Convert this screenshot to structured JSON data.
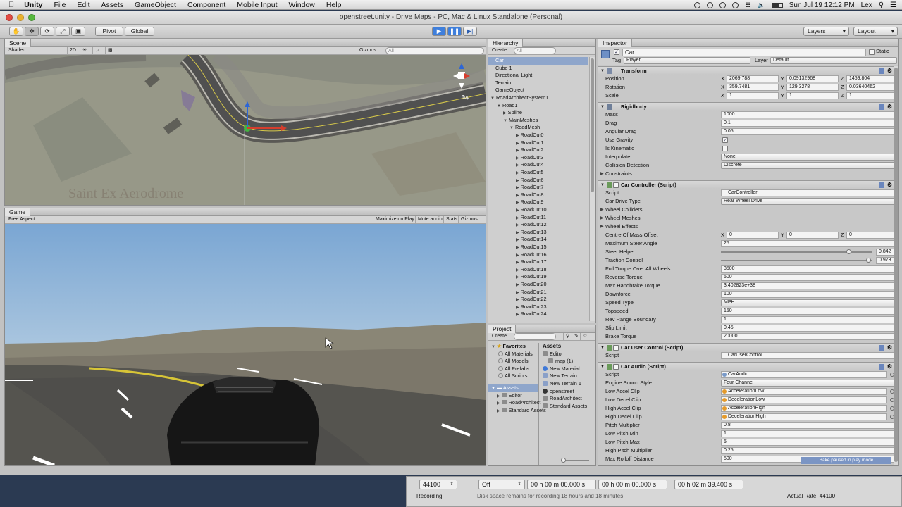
{
  "menubar": {
    "app": "Unity",
    "items": [
      "File",
      "Edit",
      "Assets",
      "GameObject",
      "Component",
      "Mobile Input",
      "Window",
      "Help"
    ],
    "clock": "Sun Jul 19  12:12 PM",
    "user": "Lex"
  },
  "window": {
    "title": "openstreet.unity - Drive Maps - PC, Mac & Linux Standalone (Personal)"
  },
  "toolbar": {
    "pivot": "Pivot",
    "global": "Global",
    "layers": "Layers",
    "layout": "Layout",
    "colors": {
      "play_active": "#3f7fdc"
    }
  },
  "scene": {
    "tab": "Scene",
    "shading": "Shaded",
    "mode2d": "2D",
    "gizmos": "Gizmos",
    "search_placeholder": "All",
    "axis_label": "Top",
    "watermark": "Saint Ex Aerodrome"
  },
  "game": {
    "tab": "Game",
    "aspect": "Free Aspect",
    "maximize": "Maximize on Play",
    "mute": "Mute audio",
    "stats": "Stats",
    "gizmos": "Gizmos"
  },
  "hierarchy": {
    "tab": "Hierarchy",
    "create": "Create",
    "search_placeholder": "All",
    "items": [
      {
        "label": "Car",
        "depth": 0,
        "arrow": "",
        "selected": true
      },
      {
        "label": "Cube 1",
        "depth": 0,
        "arrow": ""
      },
      {
        "label": "Directional Light",
        "depth": 0,
        "arrow": ""
      },
      {
        "label": "Terrain",
        "depth": 0,
        "arrow": ""
      },
      {
        "label": "GameObject",
        "depth": 0,
        "arrow": ""
      },
      {
        "label": "RoadArchitectSystem1",
        "depth": 0,
        "arrow": "▼"
      },
      {
        "label": "Road1",
        "depth": 1,
        "arrow": "▼"
      },
      {
        "label": "Spline",
        "depth": 2,
        "arrow": "▶"
      },
      {
        "label": "MainMeshes",
        "depth": 2,
        "arrow": "▼"
      },
      {
        "label": "RoadMesh",
        "depth": 3,
        "arrow": "▼"
      },
      {
        "label": "RoadCut0",
        "depth": 4,
        "arrow": "▶"
      },
      {
        "label": "RoadCut1",
        "depth": 4,
        "arrow": "▶"
      },
      {
        "label": "RoadCut2",
        "depth": 4,
        "arrow": "▶"
      },
      {
        "label": "RoadCut3",
        "depth": 4,
        "arrow": "▶"
      },
      {
        "label": "RoadCut4",
        "depth": 4,
        "arrow": "▶"
      },
      {
        "label": "RoadCut5",
        "depth": 4,
        "arrow": "▶"
      },
      {
        "label": "RoadCut6",
        "depth": 4,
        "arrow": "▶"
      },
      {
        "label": "RoadCut7",
        "depth": 4,
        "arrow": "▶"
      },
      {
        "label": "RoadCut8",
        "depth": 4,
        "arrow": "▶"
      },
      {
        "label": "RoadCut9",
        "depth": 4,
        "arrow": "▶"
      },
      {
        "label": "RoadCut10",
        "depth": 4,
        "arrow": "▶"
      },
      {
        "label": "RoadCut11",
        "depth": 4,
        "arrow": "▶"
      },
      {
        "label": "RoadCut12",
        "depth": 4,
        "arrow": "▶"
      },
      {
        "label": "RoadCut13",
        "depth": 4,
        "arrow": "▶"
      },
      {
        "label": "RoadCut14",
        "depth": 4,
        "arrow": "▶"
      },
      {
        "label": "RoadCut15",
        "depth": 4,
        "arrow": "▶"
      },
      {
        "label": "RoadCut16",
        "depth": 4,
        "arrow": "▶"
      },
      {
        "label": "RoadCut17",
        "depth": 4,
        "arrow": "▶"
      },
      {
        "label": "RoadCut18",
        "depth": 4,
        "arrow": "▶"
      },
      {
        "label": "RoadCut19",
        "depth": 4,
        "arrow": "▶"
      },
      {
        "label": "RoadCut20",
        "depth": 4,
        "arrow": "▶"
      },
      {
        "label": "RoadCut21",
        "depth": 4,
        "arrow": "▶"
      },
      {
        "label": "RoadCut22",
        "depth": 4,
        "arrow": "▶"
      },
      {
        "label": "RoadCut23",
        "depth": 4,
        "arrow": "▶"
      },
      {
        "label": "RoadCut24",
        "depth": 4,
        "arrow": "▶"
      }
    ]
  },
  "project": {
    "tab": "Project",
    "create": "Create",
    "favorites_label": "Favorites",
    "favorites": [
      "All Materials",
      "All Models",
      "All Prefabs",
      "All Scripts"
    ],
    "assets_label": "Assets",
    "folders": [
      "Editor",
      "RoadArchitect",
      "Standard Assets"
    ],
    "assets_header": "Assets",
    "assets": [
      {
        "label": "Editor",
        "icon": "folder"
      },
      {
        "label": "map (1)",
        "icon": "folder"
      },
      {
        "label": "New Material",
        "icon": "material"
      },
      {
        "label": "New Terrain",
        "icon": "terrain"
      },
      {
        "label": "New Terrain 1",
        "icon": "terrain"
      },
      {
        "label": "openstreet",
        "icon": "unity"
      },
      {
        "label": "RoadArchitect",
        "icon": "folder"
      },
      {
        "label": "Standard Assets",
        "icon": "folder"
      }
    ]
  },
  "inspector": {
    "tab": "Inspector",
    "object_name": "Car",
    "static_label": "Static",
    "tag_label": "Tag",
    "tag_value": "Player",
    "layer_label": "Layer",
    "layer_value": "Default",
    "transform": {
      "title": "Transform",
      "position": {
        "label": "Position",
        "x": "2069.788",
        "y": "0.09132968",
        "z": "1459.804"
      },
      "rotation": {
        "label": "Rotation",
        "x": "359.7481",
        "y": "129.3278",
        "z": "0.03640462"
      },
      "scale": {
        "label": "Scale",
        "x": "1",
        "y": "1",
        "z": "1"
      }
    },
    "rigidbody": {
      "title": "Rigidbody",
      "rows": [
        {
          "label": "Mass",
          "value": "1000",
          "kind": "text"
        },
        {
          "label": "Drag",
          "value": "0.1",
          "kind": "text"
        },
        {
          "label": "Angular Drag",
          "value": "0.05",
          "kind": "text"
        },
        {
          "label": "Use Gravity",
          "value": "✓",
          "kind": "check"
        },
        {
          "label": "Is Kinematic",
          "value": "",
          "kind": "check"
        },
        {
          "label": "Interpolate",
          "value": "None",
          "kind": "dd"
        },
        {
          "label": "Collision Detection",
          "value": "Discrete",
          "kind": "dd"
        }
      ],
      "constraints": "Constraints"
    },
    "car_controller": {
      "title": "Car Controller (Script)",
      "script_label": "Script",
      "script_value": "CarController",
      "drive_label": "Car Drive Type",
      "drive_value": "Rear Wheel Drive",
      "foldouts": [
        "Wheel Colliders",
        "Wheel Meshes",
        "Wheel Effects"
      ],
      "com_label": "Centre Of Mass Offset",
      "com": {
        "x": "0",
        "y": "0",
        "z": "0"
      },
      "max_steer_label": "Maximum Steer Angle",
      "max_steer": "25",
      "steer_helper_label": "Steer Helper",
      "steer_helper": 0.842,
      "steer_helper_text": "0.842",
      "traction_label": "Traction Control",
      "traction": 0.973,
      "traction_text": "0.973",
      "rows": [
        {
          "label": "Full Torque Over All Wheels",
          "value": "3500",
          "kind": "text"
        },
        {
          "label": "Reverse Torque",
          "value": "500",
          "kind": "text"
        },
        {
          "label": "Max Handbrake Torque",
          "value": "3.402823e+38",
          "kind": "text"
        },
        {
          "label": "Downforce",
          "value": "100",
          "kind": "text"
        },
        {
          "label": "Speed Type",
          "value": "MPH",
          "kind": "dd"
        },
        {
          "label": "Topspeed",
          "value": "150",
          "kind": "text"
        },
        {
          "label": "Rev Range Boundary",
          "value": "1",
          "kind": "text"
        },
        {
          "label": "Slip Limit",
          "value": "0.45",
          "kind": "text"
        },
        {
          "label": "Brake Torque",
          "value": "20000",
          "kind": "text"
        }
      ]
    },
    "car_user_control": {
      "title": "Car User Control (Script)",
      "script_label": "Script",
      "script_value": "CarUserControl"
    },
    "car_audio": {
      "title": "Car Audio (Script)",
      "rows": [
        {
          "label": "Script",
          "value": "CarAudio",
          "kind": "script"
        },
        {
          "label": "Engine Sound Style",
          "value": "Four Channel",
          "kind": "dd"
        },
        {
          "label": "Low Accel Clip",
          "value": "AccelerationLow",
          "kind": "audio"
        },
        {
          "label": "Low Decel Clip",
          "value": "DecelerationLow",
          "kind": "audio"
        },
        {
          "label": "High Accel Clip",
          "value": "AccelerationHigh",
          "kind": "audio"
        },
        {
          "label": "High Decel Clip",
          "value": "DecelerationHigh",
          "kind": "audio"
        },
        {
          "label": "Pitch Multiplier",
          "value": "0.8",
          "kind": "text"
        },
        {
          "label": "Low Pitch Min",
          "value": "1",
          "kind": "text"
        },
        {
          "label": "Low Pitch Max",
          "value": "5",
          "kind": "text"
        },
        {
          "label": "High Pitch Multiplier",
          "value": "0.25",
          "kind": "text"
        },
        {
          "label": "Max Rolloff Distance",
          "value": "500",
          "kind": "text"
        }
      ]
    },
    "bake_notice": "Bake paused in play mode"
  },
  "audio_bar": {
    "rate": "44100",
    "mode": "Off",
    "time1": "00 h 00 m 00.000 s",
    "time2": "00 h 00 m 00.000 s",
    "time3": "00 h 02 m 39.400 s",
    "status": "Recording.",
    "disk_note": "Disk space remains for recording 18 hours and 18 minutes.",
    "actual_rate": "Actual Rate: 44100"
  }
}
